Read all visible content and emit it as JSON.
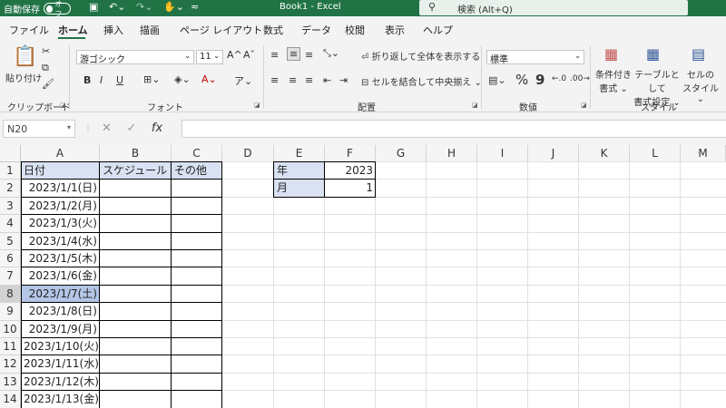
{
  "titlebar": {
    "autosave_label": "自動保存",
    "autosave_state": "オフ",
    "title": "Book1  -  Excel",
    "search_placeholder": "検索 (Alt+Q)"
  },
  "tabs": [
    "ファイル",
    "ホーム",
    "挿入",
    "描画",
    "ページ レイアウト",
    "数式",
    "データ",
    "校閲",
    "表示",
    "ヘルプ"
  ],
  "active_tab": "ホーム",
  "ribbon": {
    "clipboard": {
      "paste_label": "貼り付け",
      "group": "クリップボード"
    },
    "font": {
      "name": "游ゴシック",
      "size": "11",
      "bold": "B",
      "italic": "I",
      "underline": "U",
      "grow": "A^",
      "shrink": "Aˇ",
      "group": "フォント"
    },
    "alignment": {
      "wrap_text": "折り返して全体を表示する",
      "merge_center": "セルを結合して中央揃え",
      "group": "配置"
    },
    "number": {
      "format": "標準",
      "percent": "%",
      "comma": "9",
      "group": "数値"
    },
    "styles": {
      "conditional_1": "条件付き",
      "conditional_2": "書式",
      "table_1": "テーブルとして",
      "table_2": "書式設定",
      "cell_1": "セルの",
      "cell_2": "スタイル",
      "group": "スタイル"
    }
  },
  "formula_bar": {
    "name_box": "N20",
    "fx": "fx",
    "value": ""
  },
  "columns": [
    "A",
    "B",
    "C",
    "D",
    "E",
    "F",
    "G",
    "H",
    "I",
    "J",
    "K",
    "L",
    "M"
  ],
  "rows": [
    "1",
    "2",
    "3",
    "4",
    "5",
    "6",
    "7",
    "8",
    "9",
    "10",
    "11",
    "12",
    "13",
    "14"
  ],
  "selected_row": "8",
  "cells": {
    "A1": "日付",
    "B1": "スケジュール",
    "C1": "その他",
    "A2": "2023/1/1(日)",
    "A3": "2023/1/2(月)",
    "A4": "2023/1/3(火)",
    "A5": "2023/1/4(水)",
    "A6": "2023/1/5(木)",
    "A7": "2023/1/6(金)",
    "A8": "2023/1/7(土)",
    "A9": "2023/1/8(日)",
    "A10": "2023/1/9(月)",
    "A11": "2023/1/10(火)",
    "A12": "2023/1/11(水)",
    "A13": "2023/1/12(木)",
    "A14": "2023/1/13(金)",
    "E1": "年",
    "F1": "2023",
    "E2": "月",
    "F2": "1"
  },
  "colors": {
    "excel_green": "#217346",
    "header_fill": "#d9e1f2",
    "selected_fill": "#b4c6e7"
  }
}
